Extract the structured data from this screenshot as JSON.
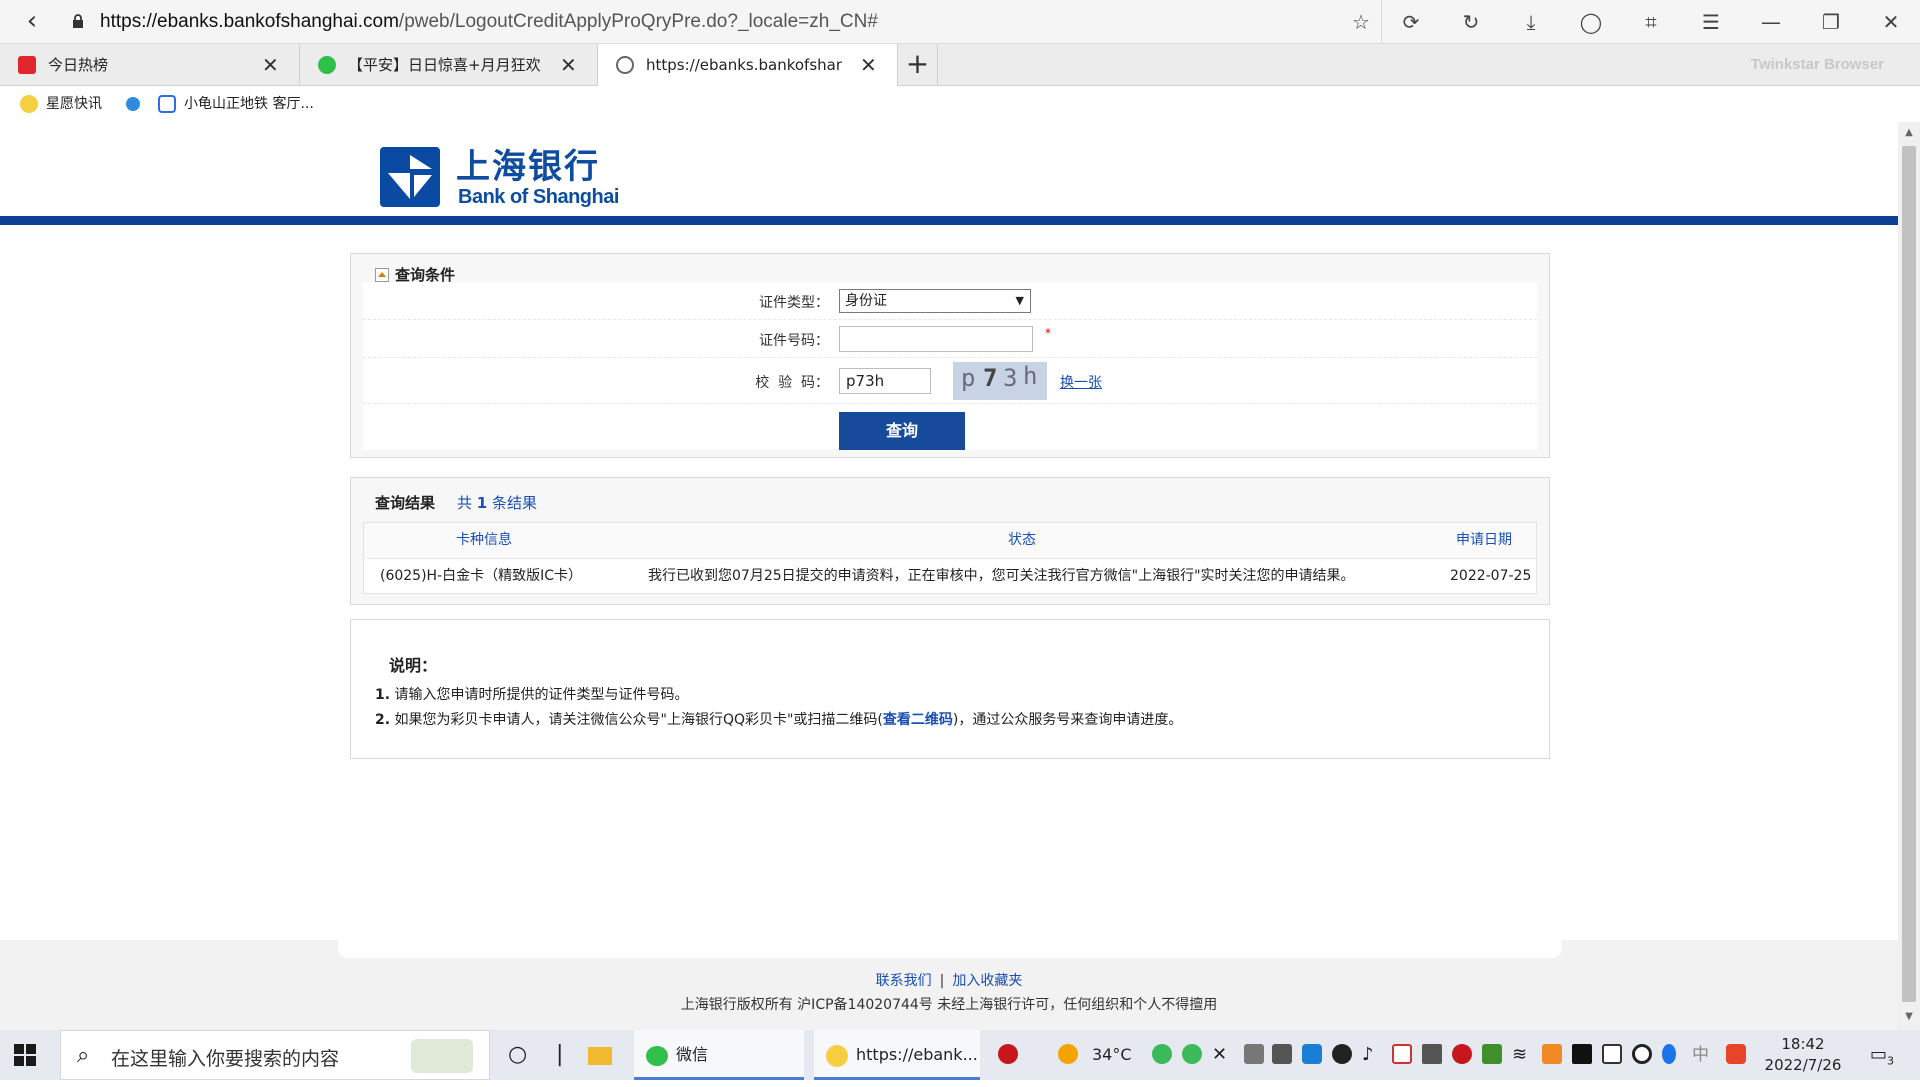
{
  "browser": {
    "url_host": "https://ebanks.bankofshanghai.com",
    "url_path": "/pweb/LogoutCreditApplyProQryPre.do?_locale=zh_CN#",
    "brand": "Twinkstar Browser",
    "tabs": [
      {
        "label": "今日热榜",
        "icon_color": "#e1262d"
      },
      {
        "label": "【平安】日日惊喜+月月狂欢",
        "icon_color": "#2fbf4a"
      },
      {
        "label": "https://ebanks.bankofshang",
        "icon_color": "#666666"
      }
    ],
    "new_tab": "+",
    "bookmarks": [
      {
        "label": "星愿快讯"
      },
      {
        "label": ""
      },
      {
        "label": "小龟山正地铁 客厅..."
      }
    ]
  },
  "page": {
    "logo_cn": "上海银行",
    "logo_en": "Bank of Shanghai",
    "query": {
      "title": "查询条件",
      "id_type_label": "证件类型：",
      "id_type_value": "身份证",
      "id_number_label": "证件号码：",
      "id_number_value": "",
      "required_mark": "*",
      "captcha_label": "校  验  码：",
      "captcha_value": "p73h",
      "captcha_chars": [
        "p",
        "7",
        "3",
        "h"
      ],
      "refresh_label": "换一张",
      "submit_label": "查询"
    },
    "results": {
      "title": "查询结果",
      "count_prefix": "共",
      "count": "1",
      "count_suffix": "条结果",
      "columns": [
        "卡种信息",
        "状态",
        "申请日期"
      ],
      "rows": [
        {
          "card": "(6025)H-白金卡（精致版IC卡）",
          "status": "我行已收到您07月25日提交的申请资料，正在审核中，您可关注我行官方微信\"上海银行\"实时关注您的申请结果。",
          "date": "2022-07-25"
        }
      ]
    },
    "notes": {
      "title": "说明：",
      "items": [
        {
          "num": "1.",
          "text": "请输入您申请时所提供的证件类型与证件号码。"
        },
        {
          "num": "2.",
          "pre": "如果您为彩贝卡申请人，请关注微信公众号\"上海银行QQ彩贝卡\"或扫描二维码(",
          "link": "查看二维码",
          "post": ")，通过公众服务号来查询申请进度。"
        }
      ]
    },
    "footer": {
      "link_contact": "联系我们",
      "sep": "|",
      "link_favorite": "加入收藏夹",
      "copyright": "上海银行版权所有 沪ICP备14020744号 未经上海银行许可，任何组织和个人不得擅用"
    }
  },
  "taskbar": {
    "search_placeholder": "在这里输入你要搜索的内容",
    "apps": [
      {
        "label": "微信"
      },
      {
        "label": "https://ebank..."
      }
    ],
    "temperature": "34°C",
    "time": "18:42",
    "date": "2022/7/26",
    "notification_count": "3",
    "ime": "中"
  }
}
